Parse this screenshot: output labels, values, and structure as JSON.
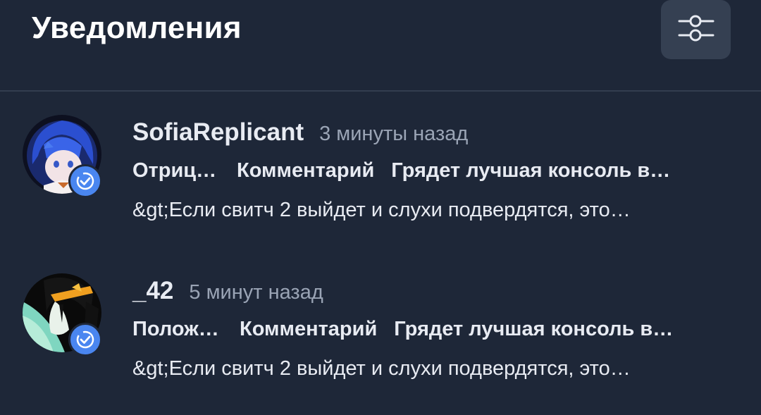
{
  "header": {
    "title": "Уведомления",
    "filter_icon": "sliders-icon"
  },
  "notifications": [
    {
      "username": "SofiaReplicant",
      "time": "3 минуты назад",
      "reaction": "Отриц…",
      "type": "Комментарий",
      "post_title": "Грядет лучшая консоль в…",
      "excerpt": "&gt;Если свитч 2 выйдет и слухи подвердятся, это…",
      "verified_icon": "verified-badge-icon"
    },
    {
      "username": "_42",
      "time": "5 минут назад",
      "reaction": "Полож…",
      "type": "Комментарий",
      "post_title": "Грядет лучшая консоль в…",
      "excerpt": "&gt;Если свитч 2 выйдет и слухи подвердятся, это…",
      "verified_icon": "verified-badge-icon"
    }
  ],
  "colors": {
    "background": "#1e2738",
    "button_bg": "#354052",
    "accent_blue": "#4a86f0",
    "muted_text": "#9aa4b5"
  }
}
